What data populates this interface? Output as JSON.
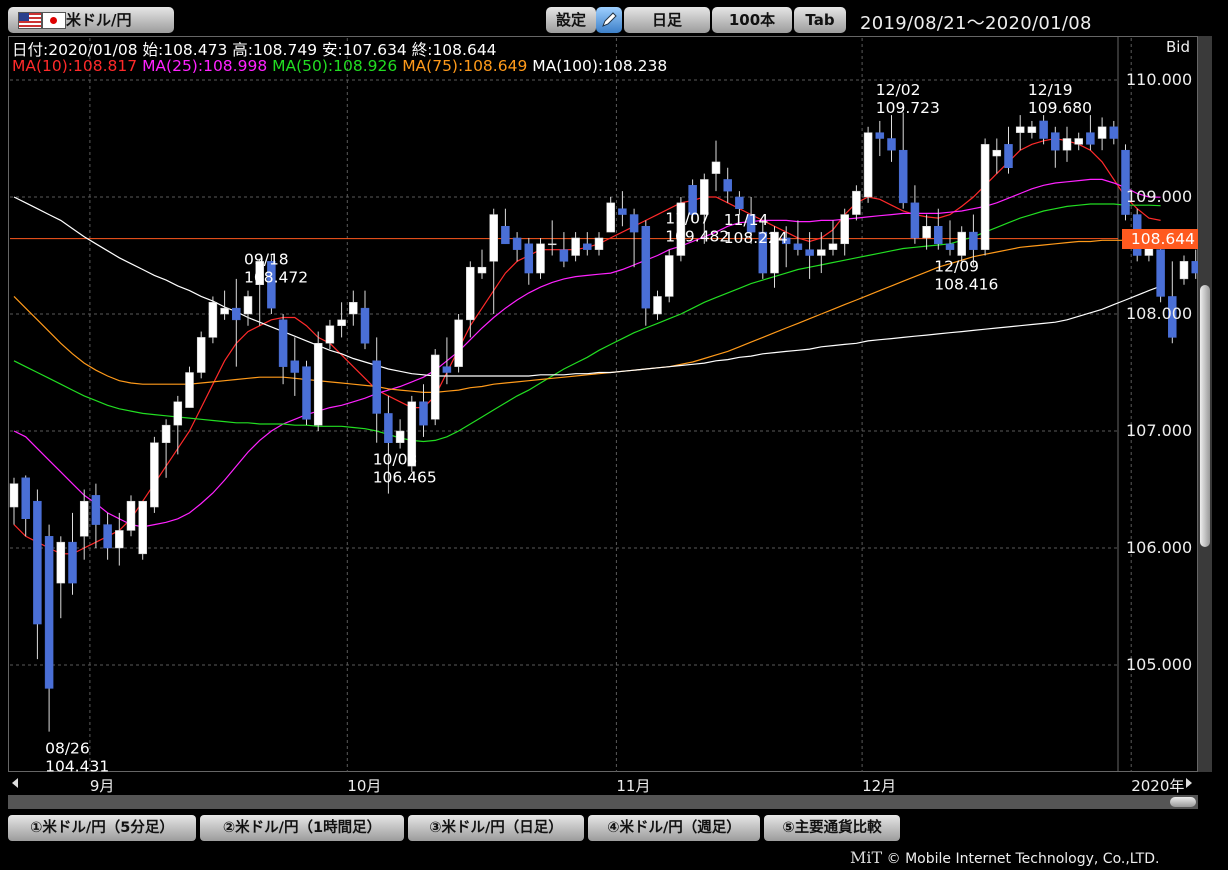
{
  "toolbar": {
    "pair": "米ドル/円",
    "settings": "設定",
    "timeframe": "日足",
    "bars": "100本",
    "tab": "Tab",
    "period": "2019/08/21～2020/01/08"
  },
  "info": {
    "ohlc": "日付:2020/01/08 始:108.473 高:108.749 安:107.634 終:108.644",
    "ma10": "MA(10):108.817",
    "ma25": "MA(25):108.998",
    "ma50": "MA(50):108.926",
    "ma75": "MA(75):108.649",
    "ma100": "MA(100):108.238",
    "bid": "Bid",
    "last_price": "108.644"
  },
  "colors": {
    "background": "#000000",
    "grid": "#5a5a5a",
    "bull_body": "#ffffff",
    "bear_body": "#4a6fd6",
    "ma10": "#ff2a2a",
    "ma25": "#ff22ff",
    "ma50": "#22dd22",
    "ma75": "#ff9a1a",
    "ma100": "#ffffff",
    "price_line": "#ff5a1f"
  },
  "tabs": [
    "①米ドル/円（5分足）",
    "②米ドル/円（1時間足）",
    "③米ドル/円（日足）",
    "④米ドル/円（週足）",
    "⑤主要通貨比較"
  ],
  "copyright": {
    "logo": "MiT",
    "text": "© Mobile Internet Technology, Co.,LTD."
  },
  "chart_data": {
    "type": "candlestick",
    "title": "米ドル/円 日足",
    "ylim": [
      104.0,
      110.5
    ],
    "y_ticks": [
      "105.000",
      "106.000",
      "107.000",
      "108.000",
      "109.000",
      "110.000"
    ],
    "x_tick_labels": [
      {
        "label": "9月",
        "index": 7
      },
      {
        "label": "10月",
        "index": 29
      },
      {
        "label": "11月",
        "index": 52
      },
      {
        "label": "12月",
        "index": 73
      },
      {
        "label": "2020年",
        "index": 96
      }
    ],
    "grid": true,
    "last_price": 108.644,
    "annotations": [
      {
        "index": 3,
        "date": "08/26",
        "value": "104.431",
        "pos": "below"
      },
      {
        "index": 20,
        "date": "09/18",
        "value": "108.472",
        "pos": "above"
      },
      {
        "index": 31,
        "date": "10/03",
        "value": "106.465",
        "pos": "below"
      },
      {
        "index": 56,
        "date": "11/07",
        "value": "109.482",
        "pos": "above"
      },
      {
        "index": 61,
        "date": "11/14",
        "value": "108.224",
        "pos": "below"
      },
      {
        "index": 74,
        "date": "12/02",
        "value": "109.723",
        "pos": "above"
      },
      {
        "index": 79,
        "date": "12/09",
        "value": "108.416",
        "pos": "below"
      },
      {
        "index": 87,
        "date": "12/19",
        "value": "109.680",
        "pos": "above"
      }
    ],
    "candles": [
      [
        106.35,
        106.6,
        106.2,
        106.55
      ],
      [
        106.6,
        106.62,
        106.1,
        106.25
      ],
      [
        106.4,
        106.5,
        105.05,
        105.35
      ],
      [
        106.1,
        106.2,
        104.431,
        104.8
      ],
      [
        105.7,
        106.1,
        105.4,
        106.05
      ],
      [
        106.05,
        106.3,
        105.6,
        105.7
      ],
      [
        106.1,
        106.5,
        105.9,
        106.4
      ],
      [
        106.45,
        106.55,
        106.0,
        106.2
      ],
      [
        106.2,
        106.3,
        105.9,
        106.0
      ],
      [
        106.0,
        106.3,
        105.85,
        106.15
      ],
      [
        106.15,
        106.45,
        106.1,
        106.4
      ],
      [
        105.95,
        106.4,
        105.9,
        106.4
      ],
      [
        106.35,
        106.95,
        106.3,
        106.9
      ],
      [
        106.9,
        107.1,
        106.6,
        107.05
      ],
      [
        107.05,
        107.3,
        106.8,
        107.25
      ],
      [
        107.2,
        107.55,
        107.2,
        107.5
      ],
      [
        107.5,
        107.85,
        107.45,
        107.8
      ],
      [
        107.8,
        108.15,
        107.75,
        108.1
      ],
      [
        108.0,
        108.2,
        107.95,
        108.05
      ],
      [
        108.05,
        108.3,
        107.55,
        107.95
      ],
      [
        108.0,
        108.2,
        107.9,
        108.15
      ],
      [
        108.25,
        108.472,
        107.9,
        108.45
      ],
      [
        108.45,
        108.5,
        108.0,
        108.05
      ],
      [
        107.95,
        108.0,
        107.4,
        107.55
      ],
      [
        107.6,
        107.8,
        107.3,
        107.5
      ],
      [
        107.55,
        107.6,
        107.05,
        107.1
      ],
      [
        107.05,
        107.85,
        107.0,
        107.75
      ],
      [
        107.75,
        107.95,
        107.7,
        107.9
      ],
      [
        107.9,
        108.1,
        107.8,
        107.95
      ],
      [
        108.0,
        108.2,
        107.9,
        108.1
      ],
      [
        108.05,
        108.2,
        107.7,
        107.75
      ],
      [
        107.6,
        107.8,
        106.9,
        107.15
      ],
      [
        107.15,
        107.3,
        106.465,
        106.9
      ],
      [
        106.9,
        107.1,
        106.85,
        107.0
      ],
      [
        106.7,
        107.3,
        106.65,
        107.25
      ],
      [
        107.25,
        107.4,
        106.95,
        107.05
      ],
      [
        107.1,
        107.7,
        107.05,
        107.65
      ],
      [
        107.55,
        107.8,
        107.4,
        107.5
      ],
      [
        107.55,
        108.0,
        107.5,
        107.95
      ],
      [
        107.95,
        108.45,
        107.8,
        108.4
      ],
      [
        108.35,
        108.55,
        108.3,
        108.4
      ],
      [
        108.45,
        108.9,
        108.0,
        108.85
      ],
      [
        108.75,
        108.9,
        108.6,
        108.6
      ],
      [
        108.65,
        108.7,
        108.45,
        108.55
      ],
      [
        108.6,
        108.65,
        108.25,
        108.35
      ],
      [
        108.35,
        108.65,
        108.3,
        108.6
      ],
      [
        108.6,
        108.8,
        108.5,
        108.6
      ],
      [
        108.55,
        108.7,
        108.4,
        108.45
      ],
      [
        108.5,
        108.7,
        108.45,
        108.65
      ],
      [
        108.6,
        108.7,
        108.5,
        108.55
      ],
      [
        108.55,
        108.7,
        108.5,
        108.65
      ],
      [
        108.7,
        109.0,
        108.7,
        108.95
      ],
      [
        108.9,
        109.05,
        108.75,
        108.85
      ],
      [
        108.85,
        108.9,
        108.4,
        108.7
      ],
      [
        108.75,
        108.8,
        107.9,
        108.05
      ],
      [
        108.0,
        108.2,
        107.95,
        108.15
      ],
      [
        108.15,
        108.55,
        108.1,
        108.5
      ],
      [
        108.5,
        109.0,
        108.45,
        108.95
      ],
      [
        109.1,
        109.15,
        108.8,
        108.85
      ],
      [
        108.85,
        109.2,
        108.6,
        109.15
      ],
      [
        109.2,
        109.482,
        109.05,
        109.3
      ],
      [
        109.15,
        109.25,
        108.95,
        109.05
      ],
      [
        109.0,
        109.05,
        108.85,
        108.9
      ],
      [
        108.85,
        109.0,
        108.6,
        108.7
      ],
      [
        108.7,
        108.8,
        108.3,
        108.35
      ],
      [
        108.35,
        108.75,
        108.224,
        108.7
      ],
      [
        108.65,
        108.75,
        108.4,
        108.6
      ],
      [
        108.6,
        108.8,
        108.5,
        108.55
      ],
      [
        108.55,
        108.7,
        108.3,
        108.5
      ],
      [
        108.5,
        108.7,
        108.35,
        108.55
      ],
      [
        108.55,
        108.8,
        108.5,
        108.6
      ],
      [
        108.6,
        108.9,
        108.5,
        108.85
      ],
      [
        108.85,
        109.1,
        108.8,
        109.05
      ],
      [
        109.0,
        109.6,
        108.95,
        109.55
      ],
      [
        109.55,
        109.65,
        109.35,
        109.5
      ],
      [
        109.5,
        109.7,
        109.3,
        109.4
      ],
      [
        109.4,
        109.723,
        108.9,
        108.95
      ],
      [
        108.95,
        109.1,
        108.6,
        108.65
      ],
      [
        108.65,
        108.85,
        108.55,
        108.75
      ],
      [
        108.75,
        108.9,
        108.55,
        108.6
      ],
      [
        108.6,
        108.8,
        108.5,
        108.55
      ],
      [
        108.5,
        108.75,
        108.45,
        108.7
      ],
      [
        108.7,
        108.85,
        108.416,
        108.55
      ],
      [
        108.55,
        109.5,
        108.5,
        109.45
      ],
      [
        109.35,
        109.5,
        109.2,
        109.4
      ],
      [
        109.45,
        109.6,
        109.2,
        109.25
      ],
      [
        109.55,
        109.7,
        109.4,
        109.6
      ],
      [
        109.55,
        109.65,
        109.5,
        109.6
      ],
      [
        109.65,
        109.7,
        109.45,
        109.5
      ],
      [
        109.55,
        109.6,
        109.25,
        109.4
      ],
      [
        109.4,
        109.6,
        109.3,
        109.5
      ],
      [
        109.45,
        109.55,
        109.4,
        109.5
      ],
      [
        109.55,
        109.7,
        109.4,
        109.45
      ],
      [
        109.5,
        109.68,
        109.4,
        109.6
      ],
      [
        109.6,
        109.65,
        109.45,
        109.5
      ],
      [
        109.4,
        109.45,
        108.8,
        108.85
      ],
      [
        108.85,
        108.9,
        108.45,
        108.5
      ],
      [
        108.5,
        108.7,
        108.45,
        108.65
      ],
      [
        108.55,
        108.65,
        108.1,
        108.15
      ],
      [
        108.15,
        108.45,
        107.75,
        107.8
      ],
      [
        108.3,
        108.5,
        108.25,
        108.45
      ],
      [
        108.45,
        108.55,
        108.3,
        108.35
      ],
      [
        108.473,
        108.749,
        107.634,
        108.644
      ]
    ],
    "ma_series": [
      {
        "name": "MA(10)",
        "color": "#ff2a2a",
        "start": 0,
        "values": [
          106.2,
          106.1,
          106.05,
          106.0,
          105.95,
          105.95,
          106.0,
          106.05,
          106.1,
          106.15,
          106.25,
          106.4,
          106.55,
          106.7,
          106.85,
          107.0,
          107.2,
          107.4,
          107.6,
          107.75,
          107.85,
          107.9,
          107.95,
          107.97,
          107.97,
          107.9,
          107.8,
          107.75,
          107.65,
          107.55,
          107.45,
          107.35,
          107.3,
          107.25,
          107.2,
          107.2,
          107.3,
          107.5,
          107.7,
          107.9,
          108.05,
          108.2,
          108.35,
          108.45,
          108.5,
          108.55,
          108.55,
          108.55,
          108.55,
          108.57,
          108.6,
          108.65,
          108.7,
          108.75,
          108.8,
          108.85,
          108.9,
          108.95,
          108.97,
          109.0,
          109.0,
          108.95,
          108.9,
          108.85,
          108.8,
          108.75,
          108.7,
          108.65,
          108.62,
          108.65,
          108.72,
          108.85,
          108.95,
          109.0,
          108.98,
          108.93,
          108.88,
          108.85,
          108.83,
          108.82,
          108.85,
          108.92,
          109.0,
          109.1,
          109.2,
          109.3,
          109.4,
          109.45,
          109.48,
          109.5,
          109.48,
          109.45,
          109.4,
          109.3,
          109.15,
          109.0,
          108.9,
          108.82,
          108.8
        ]
      },
      {
        "name": "MA(25)",
        "color": "#ff22ff",
        "start": 0,
        "values": [
          107.0,
          106.95,
          106.85,
          106.75,
          106.65,
          106.55,
          106.45,
          106.38,
          106.3,
          106.25,
          106.2,
          106.18,
          106.2,
          106.22,
          106.25,
          106.3,
          106.38,
          106.47,
          106.58,
          106.7,
          106.82,
          106.92,
          107.0,
          107.06,
          107.1,
          107.14,
          107.17,
          107.2,
          107.22,
          107.25,
          107.28,
          107.32,
          107.35,
          107.38,
          107.42,
          107.46,
          107.52,
          107.6,
          107.68,
          107.78,
          107.88,
          107.97,
          108.05,
          108.12,
          108.18,
          108.23,
          108.27,
          108.3,
          108.32,
          108.33,
          108.34,
          108.35,
          108.38,
          108.42,
          108.46,
          108.5,
          108.55,
          108.58,
          108.62,
          108.66,
          108.7,
          108.75,
          108.78,
          108.79,
          108.8,
          108.8,
          108.8,
          108.79,
          108.79,
          108.8,
          108.8,
          108.81,
          108.82,
          108.83,
          108.84,
          108.85,
          108.86,
          108.86,
          108.86,
          108.86,
          108.87,
          108.88,
          108.9,
          108.92,
          108.95,
          108.99,
          109.03,
          109.07,
          109.1,
          109.12,
          109.13,
          109.14,
          109.15,
          109.15,
          109.12,
          109.08,
          109.03,
          109.0,
          108.998
        ]
      },
      {
        "name": "MA(50)",
        "color": "#22dd22",
        "start": 0,
        "values": [
          107.6,
          107.55,
          107.5,
          107.45,
          107.4,
          107.35,
          107.3,
          107.26,
          107.22,
          107.19,
          107.17,
          107.15,
          107.14,
          107.13,
          107.12,
          107.11,
          107.1,
          107.09,
          107.08,
          107.07,
          107.07,
          107.06,
          107.06,
          107.06,
          107.05,
          107.05,
          107.04,
          107.04,
          107.04,
          107.03,
          107.02,
          107.0,
          106.97,
          106.94,
          106.92,
          106.91,
          106.92,
          106.95,
          107.0,
          107.06,
          107.12,
          107.18,
          107.24,
          107.3,
          107.35,
          107.41,
          107.47,
          107.53,
          107.58,
          107.63,
          107.69,
          107.74,
          107.79,
          107.84,
          107.88,
          107.92,
          107.96,
          108.0,
          108.05,
          108.1,
          108.14,
          108.18,
          108.22,
          108.26,
          108.29,
          108.32,
          108.35,
          108.38,
          108.4,
          108.42,
          108.44,
          108.46,
          108.48,
          108.5,
          108.52,
          108.54,
          108.56,
          108.57,
          108.58,
          108.59,
          108.6,
          108.63,
          108.66,
          108.7,
          108.74,
          108.78,
          108.82,
          108.85,
          108.88,
          108.9,
          108.92,
          108.93,
          108.94,
          108.94,
          108.94,
          108.93,
          108.93,
          108.93,
          108.926
        ]
      },
      {
        "name": "MA(75)",
        "color": "#ff9a1a",
        "start": 0,
        "values": [
          108.15,
          108.05,
          107.95,
          107.85,
          107.75,
          107.66,
          107.58,
          107.52,
          107.47,
          107.43,
          107.41,
          107.4,
          107.4,
          107.4,
          107.4,
          107.4,
          107.41,
          107.42,
          107.43,
          107.44,
          107.45,
          107.46,
          107.46,
          107.46,
          107.45,
          107.44,
          107.43,
          107.42,
          107.41,
          107.4,
          107.39,
          107.38,
          107.36,
          107.35,
          107.34,
          107.33,
          107.33,
          107.34,
          107.35,
          107.37,
          107.38,
          107.4,
          107.41,
          107.42,
          107.43,
          107.44,
          107.45,
          107.46,
          107.47,
          107.48,
          107.49,
          107.5,
          107.51,
          107.52,
          107.53,
          107.54,
          107.55,
          107.57,
          107.59,
          107.62,
          107.65,
          107.68,
          107.72,
          107.76,
          107.8,
          107.84,
          107.88,
          107.92,
          107.96,
          108.0,
          108.04,
          108.08,
          108.12,
          108.16,
          108.2,
          108.24,
          108.28,
          108.32,
          108.36,
          108.4,
          108.43,
          108.46,
          108.49,
          108.51,
          108.53,
          108.55,
          108.57,
          108.58,
          108.59,
          108.6,
          108.61,
          108.62,
          108.62,
          108.63,
          108.63,
          108.63,
          108.64,
          108.645,
          108.649
        ]
      },
      {
        "name": "MA(100)",
        "color": "#ffffff",
        "start": 0,
        "values": [
          109.0,
          108.95,
          108.9,
          108.85,
          108.8,
          108.73,
          108.66,
          108.6,
          108.54,
          108.48,
          108.43,
          108.38,
          108.33,
          108.29,
          108.24,
          108.2,
          108.15,
          108.11,
          108.06,
          108.02,
          107.97,
          107.93,
          107.89,
          107.85,
          107.81,
          107.77,
          107.73,
          107.69,
          107.66,
          107.62,
          107.59,
          107.56,
          107.53,
          107.51,
          107.49,
          107.48,
          107.47,
          107.47,
          107.47,
          107.47,
          107.47,
          107.47,
          107.47,
          107.47,
          107.47,
          107.48,
          107.48,
          107.48,
          107.49,
          107.49,
          107.5,
          107.5,
          107.51,
          107.52,
          107.53,
          107.54,
          107.55,
          107.56,
          107.57,
          107.58,
          107.6,
          107.61,
          107.63,
          107.64,
          107.66,
          107.67,
          107.68,
          107.69,
          107.7,
          107.72,
          107.73,
          107.74,
          107.75,
          107.77,
          107.78,
          107.79,
          107.8,
          107.81,
          107.82,
          107.83,
          107.84,
          107.85,
          107.86,
          107.87,
          107.88,
          107.89,
          107.9,
          107.91,
          107.92,
          107.93,
          107.95,
          107.98,
          108.01,
          108.04,
          108.08,
          108.12,
          108.16,
          108.2,
          108.238
        ]
      }
    ]
  }
}
